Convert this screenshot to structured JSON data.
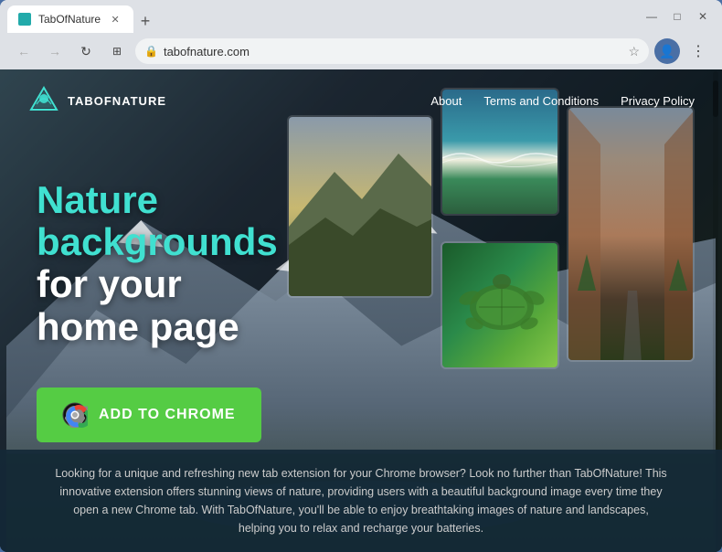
{
  "browser": {
    "tab_title": "TabOfNature",
    "new_tab_label": "+",
    "back_label": "←",
    "forward_label": "→",
    "refresh_label": "↻",
    "address_label": "⊕",
    "address_url": "tabofnature.com",
    "star_label": "☆",
    "profile_label": "👤",
    "menu_label": "⋮",
    "minimize_label": "—",
    "maximize_label": "□",
    "close_label": "✕"
  },
  "site": {
    "logo_text": "TABOFNATURE",
    "nav": {
      "about": "About",
      "terms": "Terms and Conditions",
      "privacy": "Privacy Policy"
    },
    "hero": {
      "title_line1": "Nature",
      "title_line2": "backgrounds",
      "title_line3": "for your",
      "title_line4": "home page"
    },
    "cta_button": "ADD TO CHROME",
    "description": "Looking for a unique and refreshing new tab extension for your Chrome browser? Look no further than TabOfNature! This innovative extension offers stunning views of nature, providing users with a beautiful background image every time they open a new Chrome tab. With TabOfNature, you'll be able to enjoy breathtaking images of nature and landscapes, helping you to relax and recharge your batteries."
  }
}
